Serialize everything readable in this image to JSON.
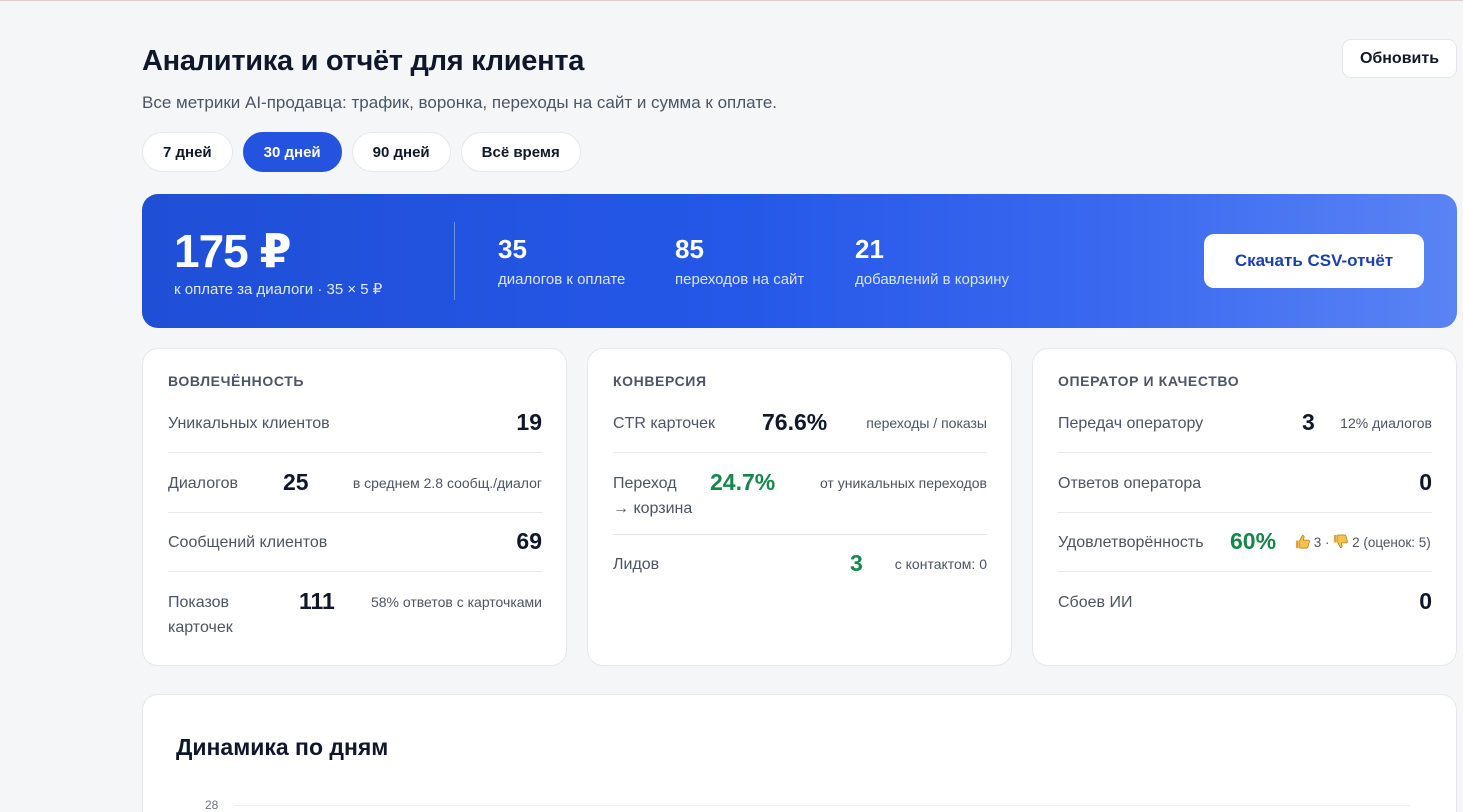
{
  "header": {
    "title": "Аналитика и отчёт для клиента",
    "subtitle": "Все метрики AI-продавца: трафик, воронка, переходы на сайт и сумма к оплате.",
    "refresh_label": "Обновить"
  },
  "period_tabs": [
    {
      "label": "7 дней",
      "active": false
    },
    {
      "label": "30 дней",
      "active": true
    },
    {
      "label": "90 дней",
      "active": false
    },
    {
      "label": "Всё время",
      "active": false
    }
  ],
  "summary": {
    "total": "175 ₽",
    "total_caption": "к оплате за диалоги · 35 × 5 ₽",
    "stats": [
      {
        "value": "35",
        "label": "диалогов к оплате"
      },
      {
        "value": "85",
        "label": "переходов на сайт"
      },
      {
        "value": "21",
        "label": "добавлений в корзину"
      }
    ],
    "csv_label": "Скачать CSV-отчёт"
  },
  "engagement": {
    "title": "ВОВЛЕЧЁННОСТЬ",
    "rows": [
      {
        "label": "Уникальных клиентов",
        "value": "19",
        "note": ""
      },
      {
        "label": "Диалогов",
        "value": "25",
        "note": "в среднем 2.8 сообщ./диалог"
      },
      {
        "label": "Сообщений клиентов",
        "value": "69",
        "note": ""
      },
      {
        "label_line1": "Показов",
        "label_line2": "карточек",
        "value": "111",
        "note": "58% ответов с карточками"
      }
    ]
  },
  "conversion": {
    "title": "КОНВЕРСИЯ",
    "rows": [
      {
        "label": "CTR карточек",
        "value": "76.6%",
        "note": "переходы / показы"
      },
      {
        "label_line1": "Переход",
        "label_line2": "→ корзина",
        "value": "24.7%",
        "note": "от уникальных переходов"
      },
      {
        "label": "Лидов",
        "value": "3",
        "note": "с контактом: 0"
      }
    ]
  },
  "operator_quality": {
    "title": "ОПЕРАТОР И КАЧЕСТВО",
    "rows": [
      {
        "label": "Передач оператору",
        "value": "3",
        "note": "12% диалогов"
      },
      {
        "label": "Ответов оператора",
        "value": "0",
        "note": ""
      },
      {
        "label": "Удовлетворённость",
        "value": "60%",
        "likes": "3 ·",
        "dislikes": "2 (оценок: 5)"
      },
      {
        "label": "Сбоев ИИ",
        "value": "0",
        "note": ""
      }
    ]
  },
  "daily_chart": {
    "title": "Динамика по дням",
    "y_tick": "28"
  },
  "colors": {
    "accent": "#2453e0",
    "positive": "#16874a",
    "banner_start": "#1f4fd6",
    "banner_end": "#5a84f4"
  },
  "icons": {
    "thumbs_up": "thumbs-up-icon",
    "thumbs_down": "thumbs-down-icon"
  }
}
